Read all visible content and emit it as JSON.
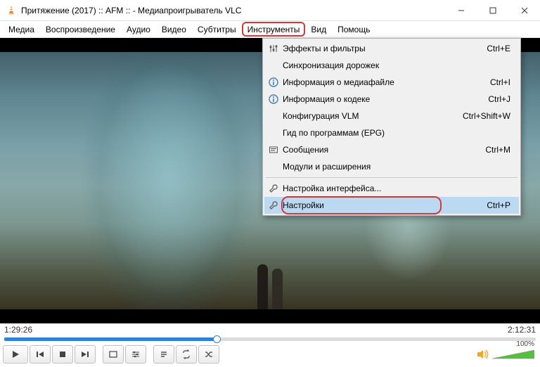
{
  "window": {
    "title": "Притяжение (2017) :: AFM :: - Медиапроигрыватель VLC"
  },
  "menubar": {
    "items": [
      {
        "label": "Медиа"
      },
      {
        "label": "Воспроизведение"
      },
      {
        "label": "Аудио"
      },
      {
        "label": "Видео"
      },
      {
        "label": "Субтитры"
      },
      {
        "label": "Инструменты",
        "highlighted": true
      },
      {
        "label": "Вид"
      },
      {
        "label": "Помощь"
      }
    ]
  },
  "dropdown": {
    "items": [
      {
        "icon": "sliders",
        "label": "Эффекты и фильтры",
        "shortcut": "Ctrl+E"
      },
      {
        "icon": "",
        "label": "Синхронизация дорожек",
        "shortcut": ""
      },
      {
        "icon": "info",
        "label": "Информация о медиафайле",
        "shortcut": "Ctrl+I"
      },
      {
        "icon": "info",
        "label": "Информация о кодеке",
        "shortcut": "Ctrl+J"
      },
      {
        "icon": "",
        "label": "Конфигурация VLM",
        "shortcut": "Ctrl+Shift+W"
      },
      {
        "icon": "",
        "label": "Гид по программам (EPG)",
        "shortcut": ""
      },
      {
        "icon": "messages",
        "label": "Сообщения",
        "shortcut": "Ctrl+M"
      },
      {
        "icon": "",
        "label": "Модули и расширения",
        "shortcut": ""
      },
      {
        "sep": true
      },
      {
        "icon": "wrench",
        "label": "Настройка интерфейса...",
        "shortcut": ""
      },
      {
        "icon": "wrench",
        "label": "Настройки",
        "shortcut": "Ctrl+P",
        "hover": true,
        "boxed": true
      }
    ]
  },
  "playback": {
    "elapsed": "1:29:26",
    "total": "2:12:31",
    "volume_pct": "100%"
  }
}
